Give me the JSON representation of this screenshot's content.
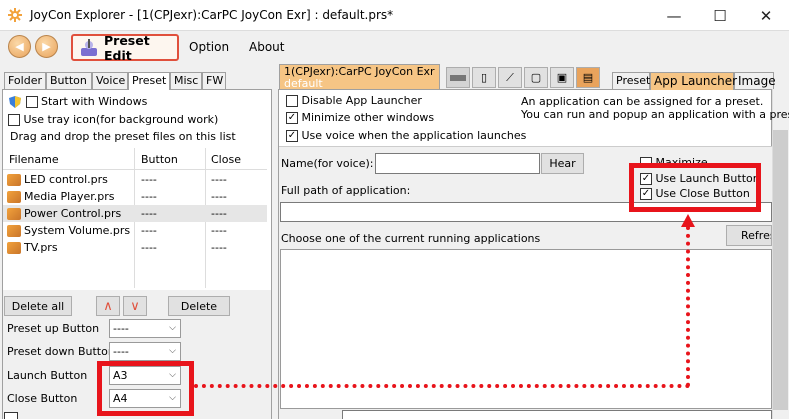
{
  "window": {
    "title": "JoyCon Explorer - [1(CPJexr):CarPC JoyCon Exr] : default.prs*",
    "minimize": "—",
    "maximize": "☐",
    "close": "✕"
  },
  "toolbar": {
    "preset_edit": "Preset Edit",
    "menu": [
      "Option",
      "About"
    ]
  },
  "left_tabs": [
    "Folder",
    "Button",
    "Voice",
    "Preset",
    "Misc",
    "FW"
  ],
  "left_panel": {
    "start_with_windows": "Start with Windows",
    "use_tray": "Use tray icon(for background work)",
    "drag_drop": "Drag and drop the preset files on this list",
    "columns": [
      "Filename",
      "Button",
      "Close"
    ],
    "files": [
      {
        "name": "LED control.prs",
        "button": "----",
        "close": "----"
      },
      {
        "name": "Media Player.prs",
        "button": "----",
        "close": "----"
      },
      {
        "name": "Power Control.prs",
        "button": "----",
        "close": "----"
      },
      {
        "name": "System Volume.prs",
        "button": "----",
        "close": "----"
      },
      {
        "name": "TV.prs",
        "button": "----",
        "close": "----"
      }
    ],
    "delete_all": "Delete all",
    "delete": "Delete",
    "preset_up_label": "Preset up Button",
    "preset_up_value": "----",
    "preset_down_label": "Preset down Button",
    "preset_down_value": "----",
    "launch_label": "Launch Button",
    "launch_value": "A3",
    "close_label": "Close Button",
    "close_value": "A4"
  },
  "device_tab": {
    "line1": "1(CPJexr):CarPC JoyCon Exr",
    "line2": "default"
  },
  "right_tabs": [
    "Preset",
    "App Launcher",
    "Image"
  ],
  "right_panel": {
    "disable_launcher": "Disable App Launcher",
    "minimize_other": "Minimize other windows",
    "use_voice": "Use voice when the application launches",
    "info_line1": "An application can be assigned for a preset.",
    "info_line2": "You can run and popup an application with a preset",
    "name_label": "Name(for voice):",
    "hear": "Hear",
    "maximize": "Maximize",
    "use_launch_button": "Use Launch Button",
    "use_close_button": "Use Close Button",
    "full_path": "Full path of application:",
    "running_apps": "Choose one of the current running applications",
    "refresh": "Refres"
  }
}
